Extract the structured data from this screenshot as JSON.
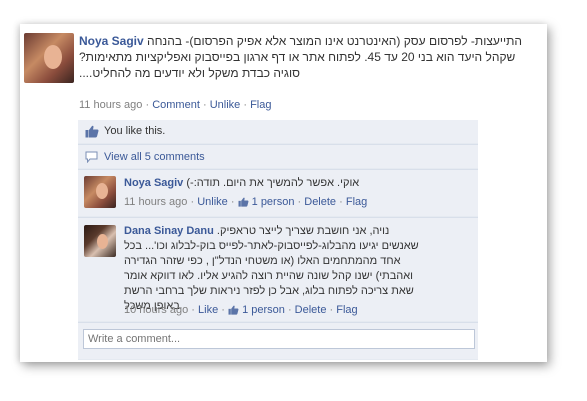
{
  "post": {
    "author": "Noya Sagiv",
    "text": "התייעצות- לפרסום עסק (האינטרנט אינו המוצר אלא אפיק הפרסום)- בהנחה שקהל היעד הוא בני 20 עד 45. לפתוח אתר או דף ארגון בפייסבוק ואפליקציות מתאימות? סוגיה כבדת משקל ולא יודעים מה להחליט....",
    "time": "11 hours ago",
    "separator": "·",
    "comment_link": "Comment",
    "unlike_link": "Unlike",
    "flag_link": "Flag"
  },
  "feedback": {
    "like_text": "You like this.",
    "view_all": "View all 5 comments",
    "write_placeholder": "Write a comment..."
  },
  "comments": [
    {
      "author": "Noya Sagiv",
      "text": "אוקי. אפשר להמשיך את היום. תודה:-)",
      "time": "11 hours ago",
      "unlike": "Unlike",
      "likes": "1 person",
      "delete": "Delete",
      "flag": "Flag"
    },
    {
      "author": "Dana Sinay Danu",
      "text": "נויה, אני חושבת שצריך לייצר טראפיק. שאנשים יגיעו מהבלוג-לפייסבוק-לאתר-לפייס בוק-לבלוג וכו'... בכל אחד מהמתחמים האלו (או משטחי הנדל\"ן , כפי שזהר הגדירה ואהבתי) ישנו קהל שונה שהיית רוצה להגיע אליו. לאו דווקא אומר שאת צריכה לפתוח בלוג, אבל כן לפזר ניראות שלך ברחבי הרשת באופן משכל",
      "time": "10 hours ago",
      "like": "Like",
      "likes": "1 person",
      "delete": "Delete",
      "flag": "Flag"
    }
  ],
  "colors": {
    "link": "#3b5998",
    "feedback_bg": "#eceff5",
    "meta": "#808080"
  }
}
